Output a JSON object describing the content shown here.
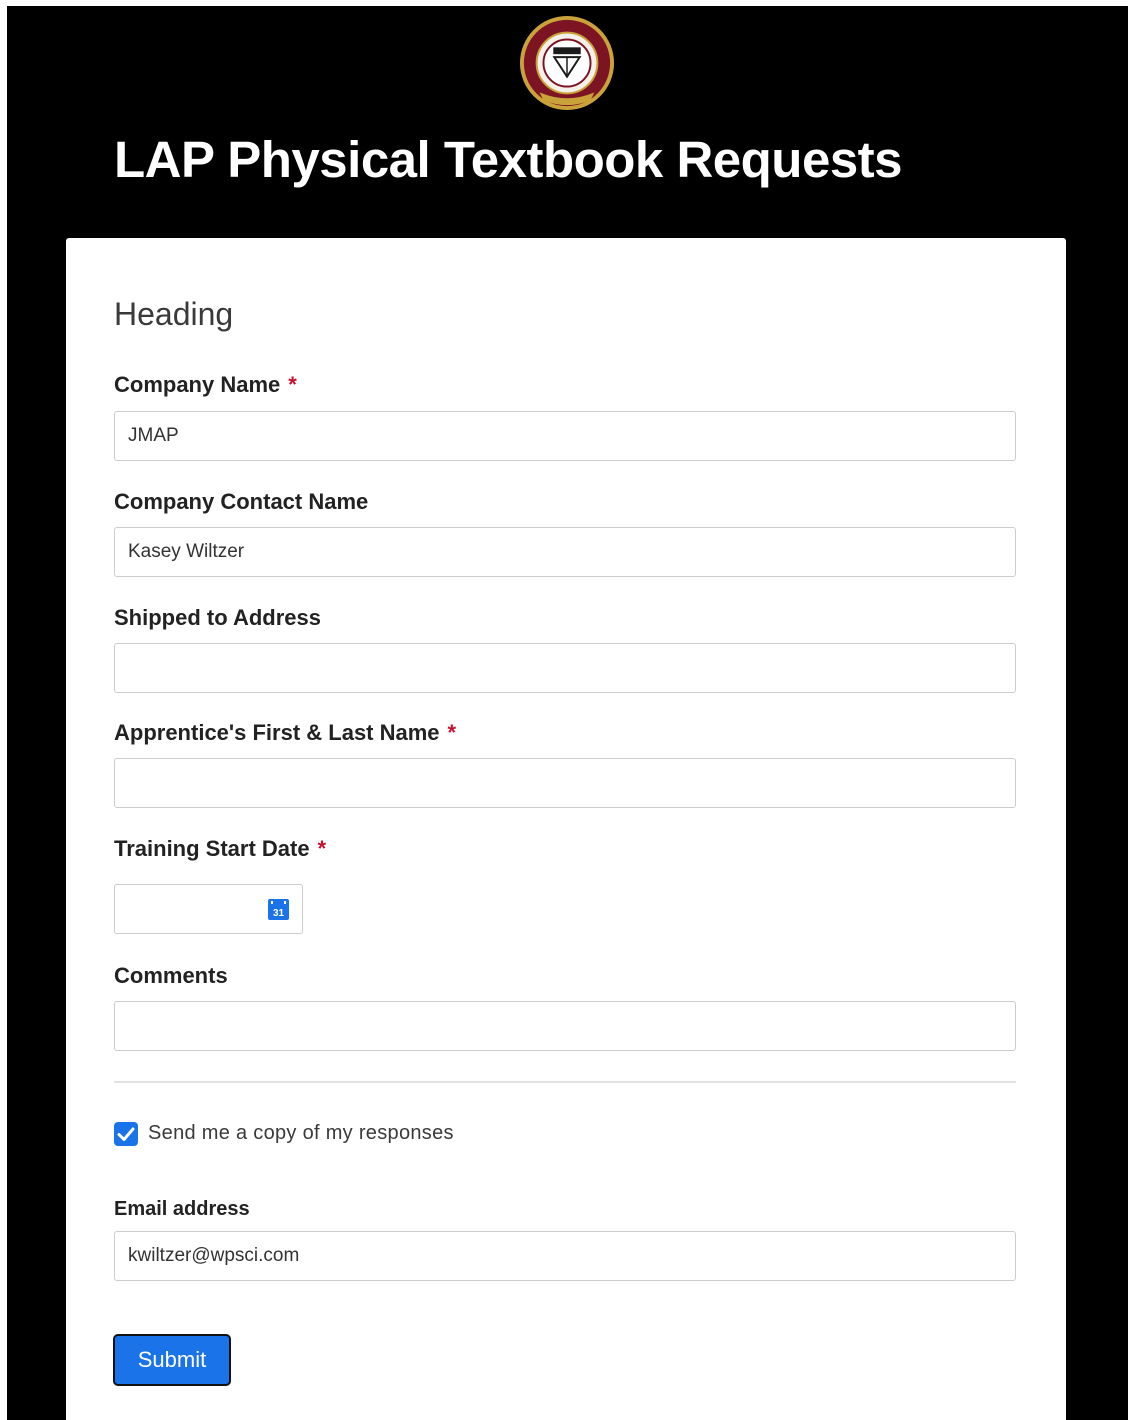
{
  "header": {
    "logo_icon": "circular-seal-logo",
    "title": "LAP Physical Textbook Requests"
  },
  "form": {
    "heading": "Heading",
    "fields": {
      "company_name": {
        "label": "Company Name",
        "required_mark": "*",
        "value": "JMAP"
      },
      "company_contact_name": {
        "label": "Company Contact Name",
        "value": "Kasey Wiltzer"
      },
      "shipped_to_address": {
        "label": "Shipped to Address",
        "value": ""
      },
      "apprentice_name": {
        "label": "Apprentice's First & Last Name",
        "required_mark": "*",
        "value": ""
      },
      "training_start_date": {
        "label": "Training Start Date",
        "required_mark": "*",
        "value": "",
        "icon": "calendar-icon"
      },
      "comments": {
        "label": "Comments",
        "value": ""
      }
    },
    "send_copy": {
      "label": "Send me a copy of my responses",
      "checked": true
    },
    "email": {
      "label": "Email address",
      "value": "kwiltzer@wpsci.com"
    },
    "submit_label": "Submit"
  },
  "colors": {
    "page_background": "#000000",
    "accent": "#1a73e8",
    "required": "#c8102e"
  }
}
